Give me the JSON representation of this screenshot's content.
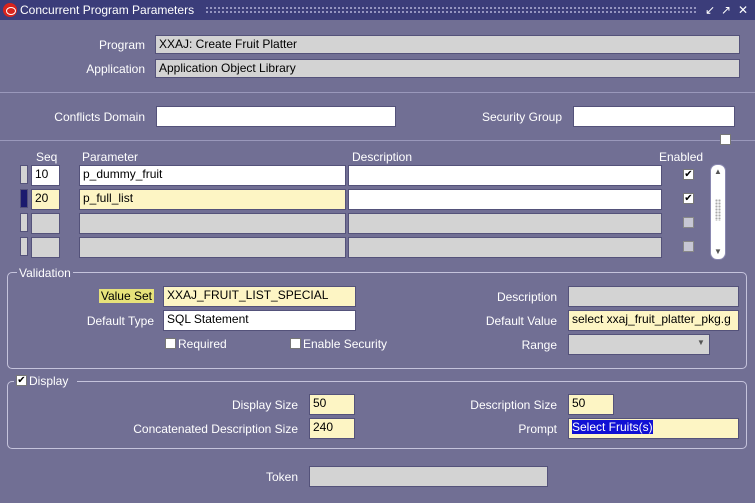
{
  "window": {
    "title": "Concurrent Program Parameters"
  },
  "header": {
    "program_label": "Program",
    "program_value": "XXAJ: Create Fruit Platter",
    "application_label": "Application",
    "application_value": "Application Object Library",
    "conflicts_label": "Conflicts Domain",
    "conflicts_value": "",
    "security_group_label": "Security Group",
    "security_group_value": ""
  },
  "table": {
    "col_seq": "Seq",
    "col_parameter": "Parameter",
    "col_description": "Description",
    "col_enabled": "Enabled",
    "rows": [
      {
        "seq": "10",
        "parameter": "p_dummy_fruit",
        "description": "",
        "enabled": "✔"
      },
      {
        "seq": "20",
        "parameter": "p_full_list",
        "description": "",
        "enabled": "✔"
      },
      {
        "seq": "",
        "parameter": "",
        "description": "",
        "enabled": ""
      },
      {
        "seq": "",
        "parameter": "",
        "description": "",
        "enabled": ""
      }
    ]
  },
  "validation": {
    "title": "Validation",
    "value_set_label": "Value Set",
    "value_set_value": "XXAJ_FRUIT_LIST_SPECIAL",
    "description_label": "Description",
    "description_value": "",
    "default_type_label": "Default Type",
    "default_type_value": "SQL Statement",
    "default_value_label": "Default Value",
    "default_value_value": "select xxaj_fruit_platter_pkg.g",
    "required_label": "Required",
    "enable_security_label": "Enable Security",
    "range_label": "Range",
    "range_value": ""
  },
  "display": {
    "title": "Display",
    "checked": "✔",
    "display_size_label": "Display Size",
    "display_size_value": "50",
    "description_size_label": "Description Size",
    "description_size_value": "50",
    "concat_size_label": "Concatenated Description Size",
    "concat_size_value": "240",
    "prompt_label": "Prompt",
    "prompt_value": "Select Fruits(s)"
  },
  "token": {
    "label": "Token",
    "value": ""
  }
}
